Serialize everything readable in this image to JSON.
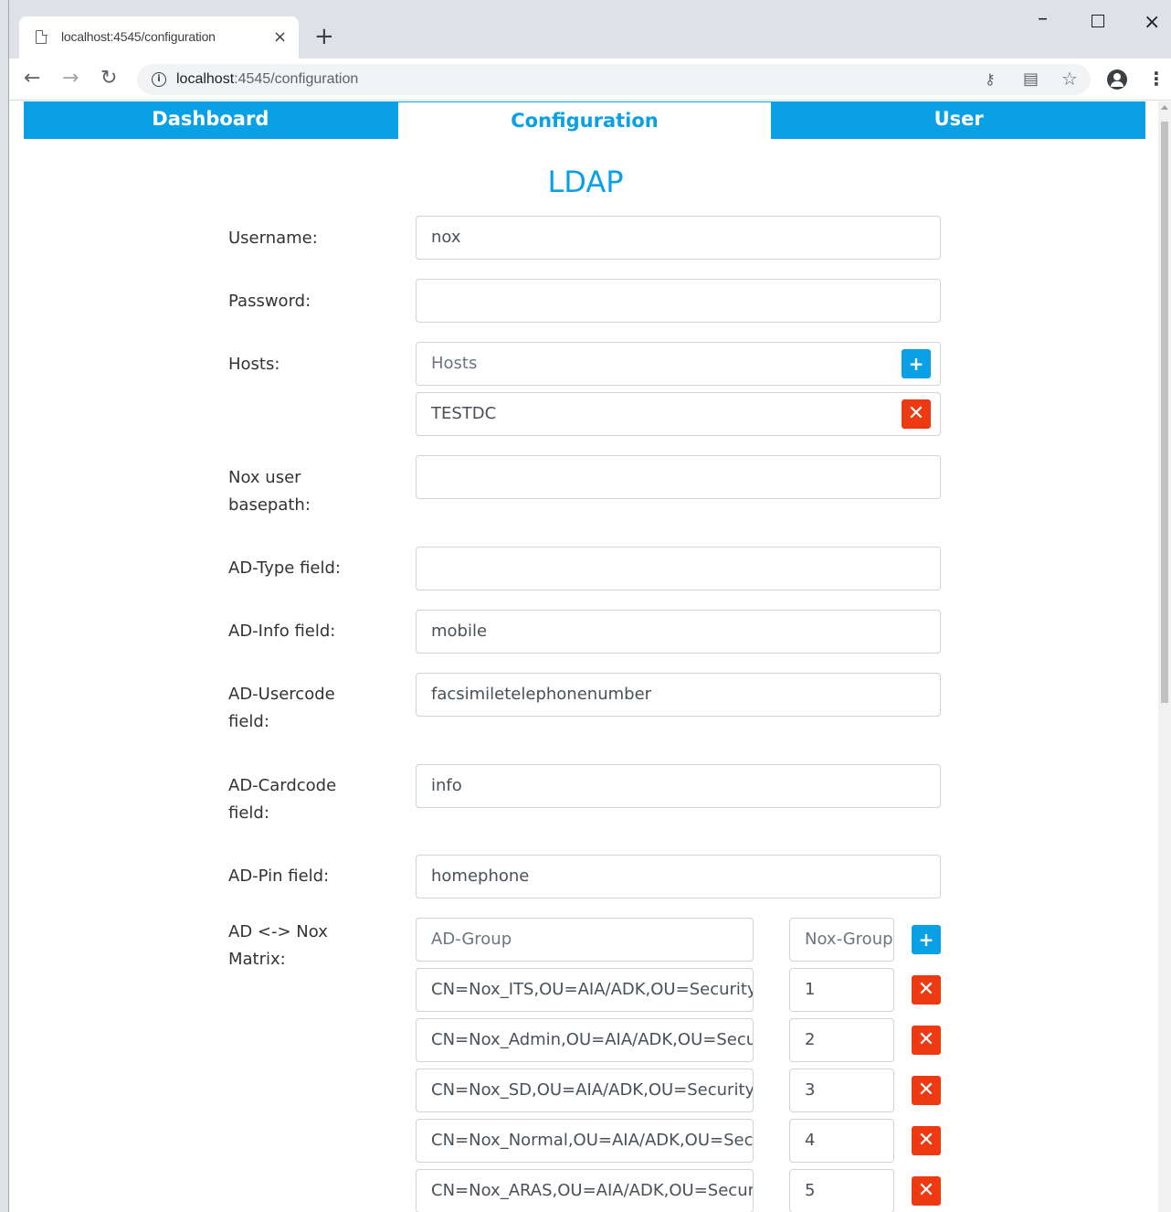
{
  "browser": {
    "tab_title": "localhost:4545/configuration",
    "tab_close_icon": "×",
    "new_tab_icon": "+",
    "url_host": "localhost",
    "url_path": ":4545/configuration",
    "minimize_icon": "–",
    "close_icon": "×"
  },
  "nav": {
    "tabs": [
      {
        "label": "Dashboard"
      },
      {
        "label": "Configuration"
      },
      {
        "label": "User"
      }
    ],
    "active_tab": "Configuration",
    "accent_color": "#0aa0e6"
  },
  "section": {
    "title": "LDAP"
  },
  "form": {
    "username": {
      "label": "Username:",
      "value": "nox"
    },
    "password": {
      "label": "Password:",
      "value": ""
    },
    "hosts": {
      "label": "Hosts:",
      "placeholder": "Hosts",
      "add_label": "+",
      "items": [
        {
          "value": "TESTDC",
          "remove_label": "✕"
        }
      ]
    },
    "nox_user_basepath": {
      "label_line1": "Nox user",
      "label_line2": "basepath:",
      "value": ""
    },
    "ad_type_field": {
      "label": "AD-Type field:",
      "value": ""
    },
    "ad_info_field": {
      "label": "AD-Info field:",
      "value": "mobile"
    },
    "ad_usercode_field": {
      "label_line1": "AD-Usercode",
      "label_line2": "field:",
      "value": "facsimiletelephonenumber"
    },
    "ad_cardcode_field": {
      "label_line1": "AD-Cardcode",
      "label_line2": "field:",
      "value": "info"
    },
    "ad_pin_field": {
      "label": "AD-Pin field:",
      "value": "homephone"
    },
    "matrix": {
      "label_line1": "AD <-> Nox",
      "label_line2": "Matrix:",
      "group_placeholder": "AD-Group",
      "nox_placeholder": "Nox-Group",
      "add_label": "+",
      "remove_label": "✕",
      "rows": [
        {
          "group": "CN=Nox_ITS,OU=AIA/ADK,OU=Security Groups",
          "nox": "1"
        },
        {
          "group": "CN=Nox_Admin,OU=AIA/ADK,OU=Security Groups",
          "nox": "2"
        },
        {
          "group": "CN=Nox_SD,OU=AIA/ADK,OU=Security Groups",
          "nox": "3"
        },
        {
          "group": "CN=Nox_Normal,OU=AIA/ADK,OU=Security Groups",
          "nox": "4"
        },
        {
          "group": "CN=Nox_ARAS,OU=AIA/ADK,OU=Security Groups",
          "nox": "5"
        }
      ]
    },
    "colors": {
      "add_button": "#0aa0e6",
      "remove_button": "#ee3a12"
    }
  }
}
